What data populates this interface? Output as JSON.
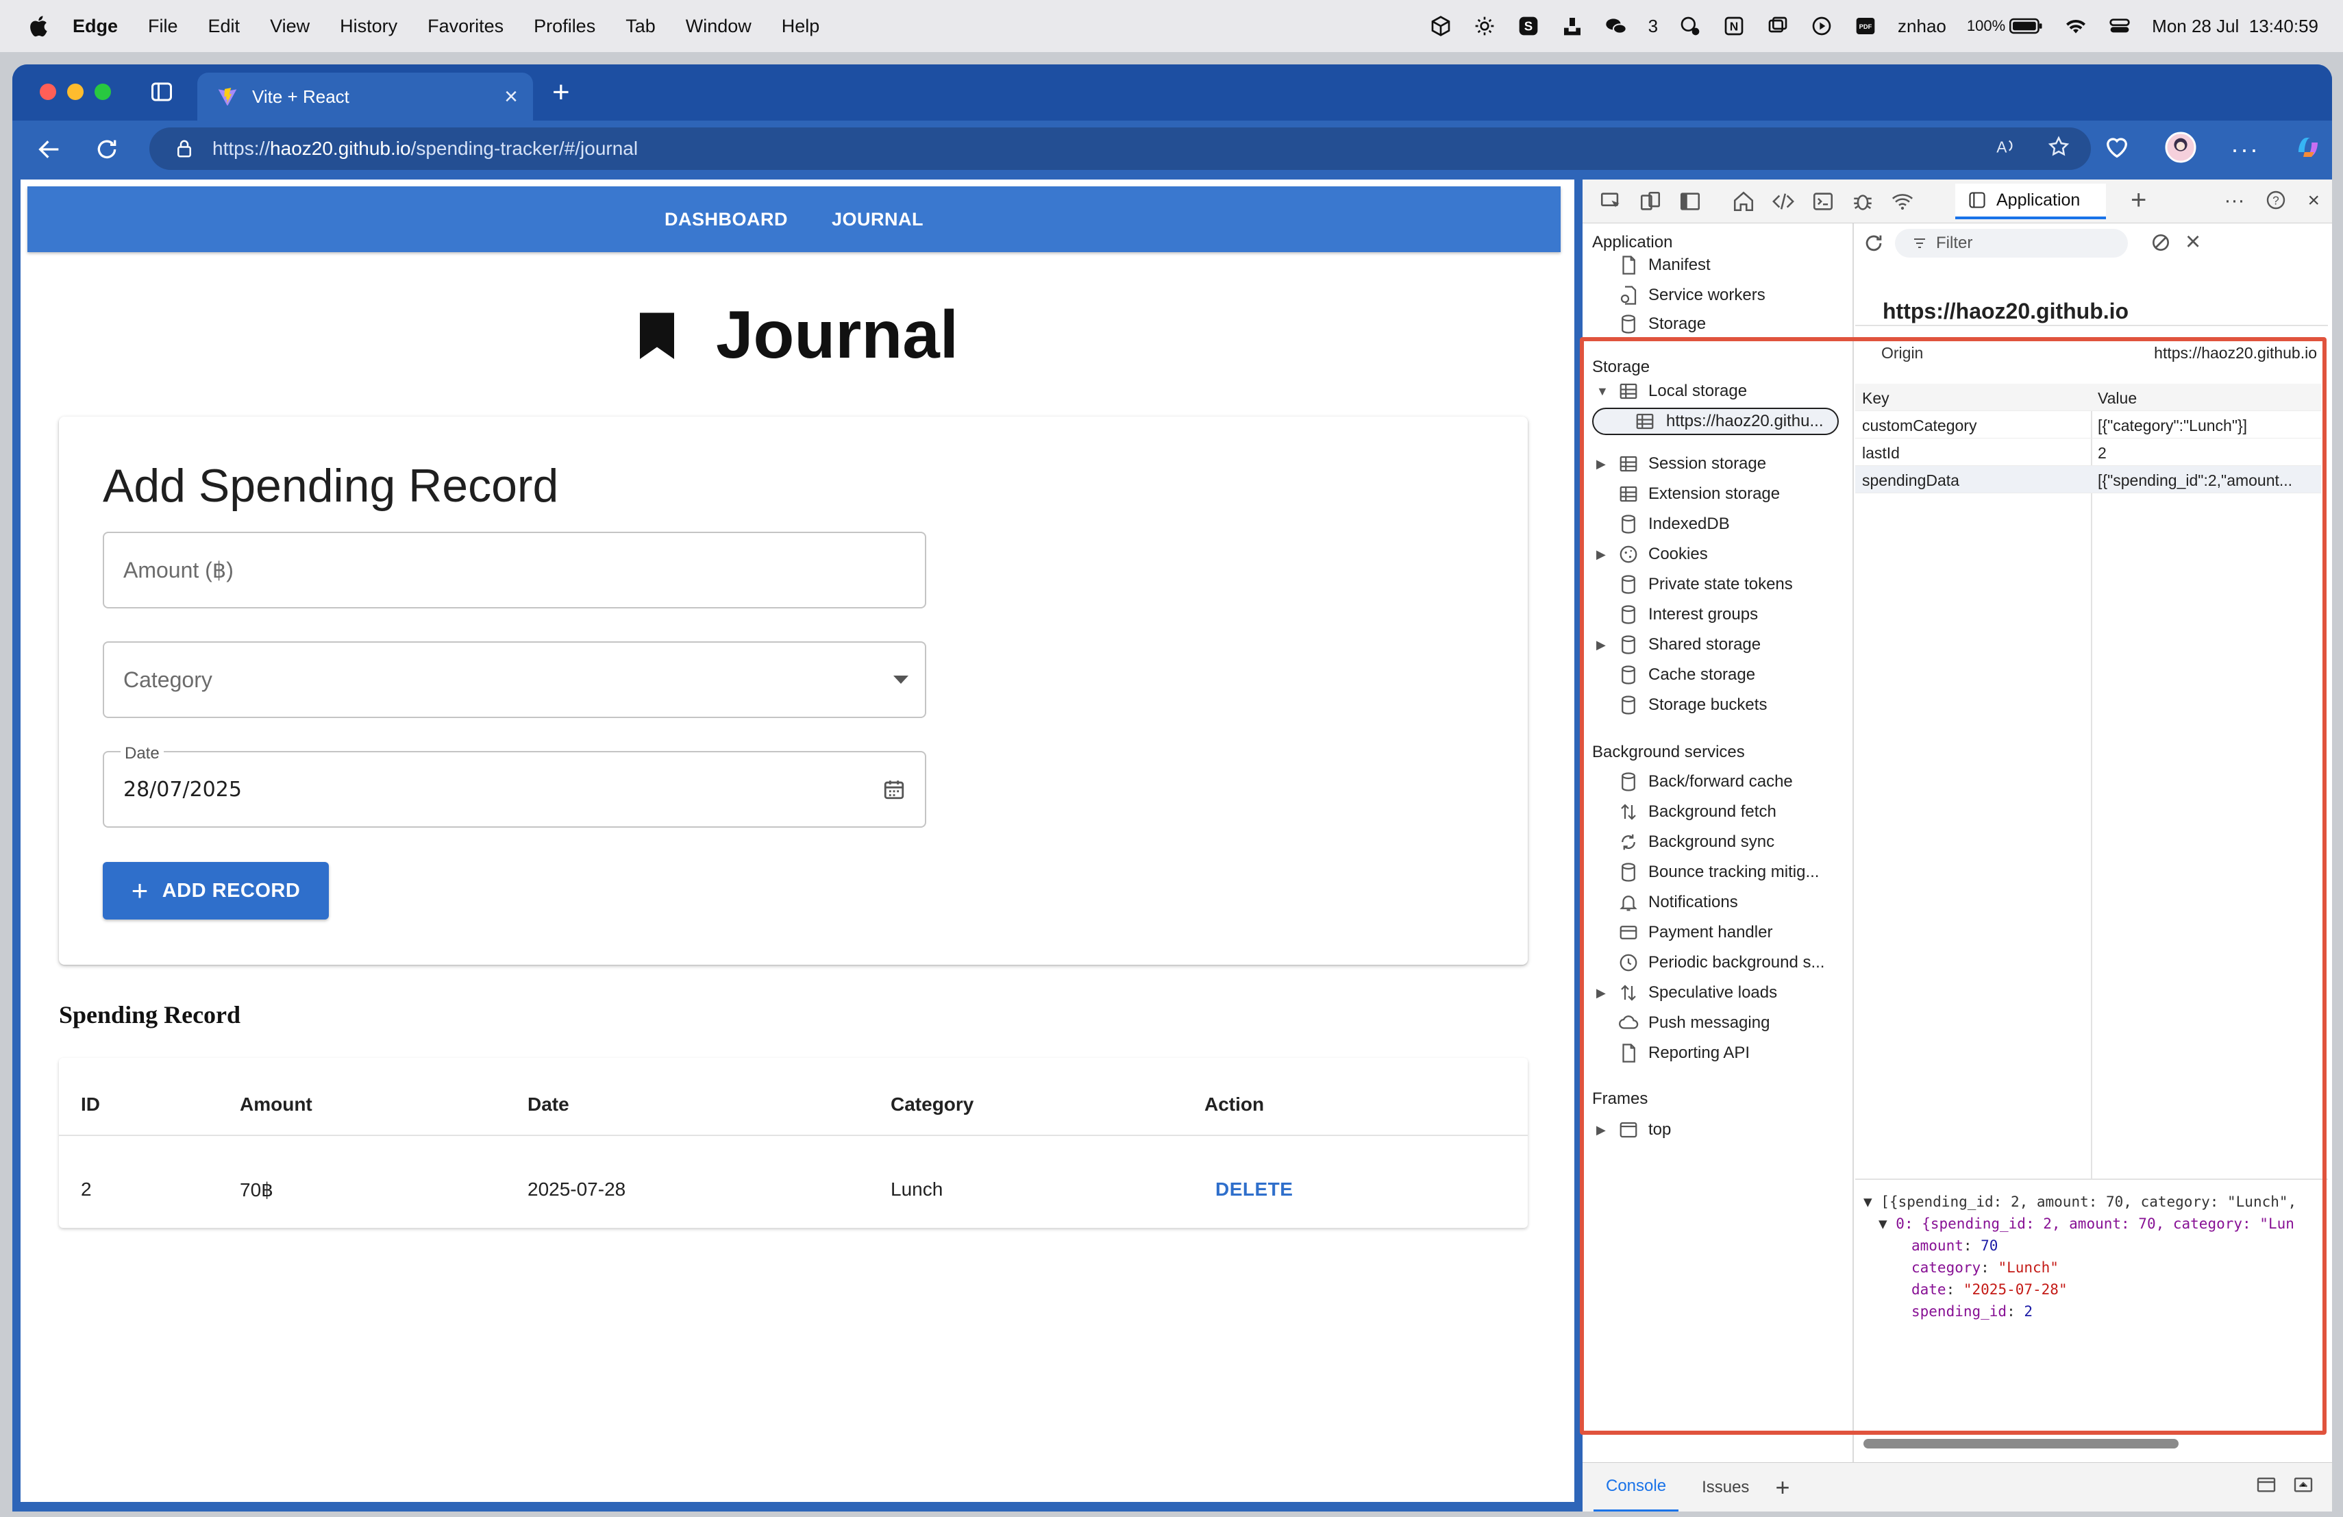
{
  "menubar": {
    "app": "Edge",
    "items": [
      "File",
      "Edit",
      "View",
      "History",
      "Favorites",
      "Profiles",
      "Tab",
      "Window",
      "Help"
    ],
    "wechat_count": "3",
    "user": "znhao",
    "battery": "100%",
    "datetime": "Mon 28 Jul  13:40:59"
  },
  "browser": {
    "tab_title": "Vite + React",
    "url_scheme": "https://",
    "url_host": "haoz20.github.io",
    "url_path": "/spending-tracker/#/journal"
  },
  "app": {
    "nav": [
      "DASHBOARD",
      "JOURNAL"
    ],
    "title": "Journal",
    "form": {
      "title": "Add Spending Record",
      "amount_placeholder": "Amount (฿)",
      "category_placeholder": "Category",
      "date_label": "Date",
      "date_value": "28/07/2025",
      "submit_label": "ADD RECORD"
    },
    "records": {
      "title": "Spending Record",
      "columns": [
        "ID",
        "Amount",
        "Date",
        "Category",
        "Action"
      ],
      "rows": [
        {
          "id": "2",
          "amount": "70฿",
          "date": "2025-07-28",
          "category": "Lunch",
          "action": "DELETE"
        }
      ]
    }
  },
  "devtools": {
    "active_tab": "Application",
    "filter_placeholder": "Filter",
    "sidebar": {
      "application_header": "Application",
      "application_items": [
        "Manifest",
        "Service workers",
        "Storage"
      ],
      "storage_header": "Storage",
      "local_storage": "Local storage",
      "local_storage_origin": "https://haoz20.githu...",
      "storage_items": [
        "Session storage",
        "Extension storage",
        "IndexedDB",
        "Cookies",
        "Private state tokens",
        "Interest groups",
        "Shared storage",
        "Cache storage",
        "Storage buckets"
      ],
      "background_header": "Background services",
      "background_items": [
        "Back/forward cache",
        "Background fetch",
        "Background sync",
        "Bounce tracking mitig...",
        "Notifications",
        "Payment handler",
        "Periodic background s...",
        "Speculative loads",
        "Push messaging",
        "Reporting API"
      ],
      "frames_header": "Frames",
      "frames_items": [
        "top"
      ]
    },
    "main": {
      "origin_heading": "https://haoz20.github.io",
      "origin_label": "Origin",
      "origin_value": "https://haoz20.github.io",
      "key_header": "Key",
      "value_header": "Value",
      "entries": [
        {
          "key": "customCategory",
          "value": "[{\"category\":\"Lunch\"}]"
        },
        {
          "key": "lastId",
          "value": "2"
        },
        {
          "key": "spendingData",
          "value": "[{\"spending_id\":2,\"amount..."
        }
      ],
      "preview": {
        "line1": "[{spending_id: 2, amount: 70, category: \"Lunch\",",
        "line2": "0: {spending_id: 2, amount: 70, category: \"Lun",
        "amount_key": "amount",
        "amount_val": "70",
        "category_key": "category",
        "category_val": "\"Lunch\"",
        "date_key": "date",
        "date_val": "\"2025-07-28\"",
        "id_key": "spending_id",
        "id_val": "2"
      }
    },
    "drawer": [
      "Console",
      "Issues"
    ]
  },
  "colors": {
    "app_primary": "#3a78cf",
    "browser_chrome": "#2e65b8",
    "highlight_frame": "#e0533d",
    "devtools_accent": "#1a73e8"
  }
}
